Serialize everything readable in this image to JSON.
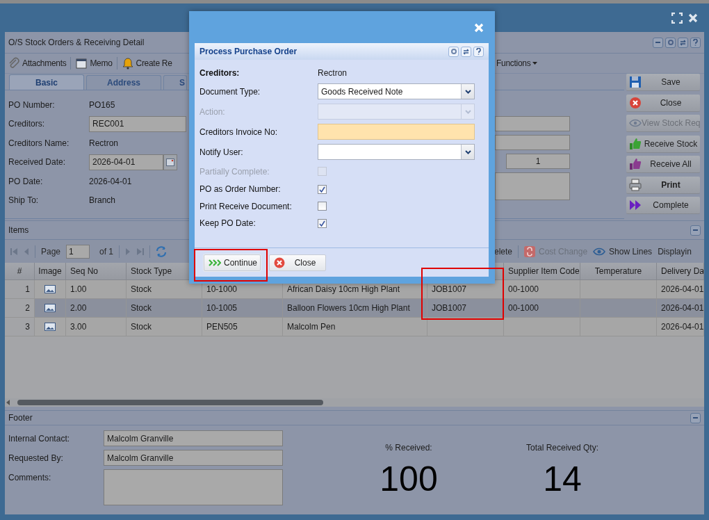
{
  "panel": {
    "title": "O/S Stock Orders & Receiving Detail"
  },
  "toolbar": [
    {
      "label": "Attachments",
      "kind": "attach"
    },
    {
      "label": "Memo",
      "kind": "memo"
    },
    {
      "label": "Create Re",
      "kind": "bell"
    },
    {
      "label": "Functions",
      "kind": "menu"
    }
  ],
  "tabs": [
    {
      "label": "Basic",
      "selected": true
    },
    {
      "label": "Address",
      "selected": false
    },
    {
      "label": "S",
      "selected": false
    }
  ],
  "form": [
    {
      "label": "PO Number:",
      "value": "PO165",
      "kind": "text"
    },
    {
      "label": "Creditors:",
      "value": "REC001",
      "kind": "field"
    },
    {
      "label": "Creditors Name:",
      "value": "Rectron",
      "kind": "text"
    },
    {
      "label": "Received Date:",
      "value": "2026-04-01",
      "kind": "date"
    },
    {
      "label": "PO Date:",
      "value": "2026-04-01",
      "kind": "text"
    },
    {
      "label": "Ship To:",
      "value": "Branch",
      "kind": "text"
    }
  ],
  "form_right": [
    {
      "kind": "field"
    },
    {
      "kind": "field"
    },
    {
      "kind": "number",
      "value": "1"
    },
    {
      "kind": "area"
    }
  ],
  "actions": [
    {
      "label": "Save",
      "kind": "save",
      "disabled": false
    },
    {
      "label": "Close",
      "kind": "close",
      "disabled": false
    },
    {
      "label": "View Stock Req",
      "kind": "view",
      "disabled": true
    },
    {
      "label": "Receive Stock",
      "kind": "thumb-green",
      "disabled": false
    },
    {
      "label": "Receive All",
      "kind": "thumb-purple",
      "disabled": false
    },
    {
      "label": "Print",
      "kind": "print",
      "disabled": false
    },
    {
      "label": "Complete",
      "kind": "forward",
      "disabled": false
    }
  ],
  "items": {
    "title": "Items",
    "pager": {
      "page_label": "Page",
      "page": "1",
      "of": "of 1"
    },
    "tools": [
      {
        "label": "elete",
        "kind": "plain",
        "disabled": false
      },
      {
        "label": "Cost Change",
        "kind": "cost",
        "disabled": true
      },
      {
        "label": "Show Lines",
        "kind": "eye",
        "disabled": false
      },
      {
        "label": "Displayin",
        "kind": "plain",
        "disabled": false
      }
    ],
    "columns": [
      "#",
      "Image",
      "Seq No",
      "Stock Type",
      null,
      null,
      null,
      "Supplier Item Code",
      "Temperature",
      "Delivery Da"
    ],
    "column_7_highlighted": true,
    "rows": [
      {
        "num": "1",
        "seq_no": "1.00",
        "stock_type": "Stock",
        "column_5": "10-1000",
        "column_6": "African Daisy 10cm High Plant",
        "column_7": "JOB1007",
        "supplier_item_code": "00-1000",
        "delivery_date": "2026-04-01",
        "selected": false
      },
      {
        "num": "2",
        "seq_no": "2.00",
        "stock_type": "Stock",
        "column_5": "10-1005",
        "column_6": "Balloon Flowers 10cm High Plant",
        "column_7": "JOB1007",
        "supplier_item_code": "00-1000",
        "delivery_date": "2026-04-01",
        "selected": true
      },
      {
        "num": "3",
        "seq_no": "3.00",
        "stock_type": "Stock",
        "column_5": "PEN505",
        "column_6": "Malcolm Pen",
        "delivery_date": "2026-04-01",
        "selected": false
      }
    ]
  },
  "footer": {
    "title": "Footer",
    "fields": [
      {
        "label": "Internal Contact:",
        "value": "Malcolm Granville",
        "kind": "field"
      },
      {
        "label": "Requested By:",
        "value": "Malcolm Granville",
        "kind": "field"
      },
      {
        "label": "Comments:",
        "kind": "area"
      }
    ],
    "stats": [
      {
        "label": "% Received:",
        "value": "100"
      },
      {
        "label": "Total Received Qty:",
        "value": "14"
      }
    ]
  },
  "dialog": {
    "title": "Process Purchase Order",
    "fields": [
      {
        "kind": "static",
        "label": "Creditors:",
        "value": "Rectron"
      },
      {
        "kind": "select",
        "label": "Document Type:",
        "value": "Goods Received Note",
        "disabled": false
      },
      {
        "kind": "select",
        "label": "Action:",
        "disabled": true
      },
      {
        "kind": "input",
        "label": "Creditors Invoice No:",
        "required": true
      },
      {
        "kind": "select",
        "label": "Notify User:",
        "disabled": false
      },
      {
        "kind": "checkbox",
        "label": "Partially Complete:",
        "checked": false,
        "disabled": true
      },
      {
        "kind": "checkbox",
        "label": "PO as Order Number:",
        "checked": true,
        "disabled": false
      },
      {
        "kind": "checkbox",
        "label": "Print Receive Document:",
        "checked": false,
        "disabled": false
      },
      {
        "kind": "checkbox",
        "label": "Keep PO Date:",
        "checked": true,
        "disabled": false
      }
    ],
    "buttons": [
      {
        "label": "Continue",
        "kind": "continue",
        "highlighted": true
      },
      {
        "label": "Close",
        "kind": "close",
        "highlighted": false
      }
    ]
  }
}
